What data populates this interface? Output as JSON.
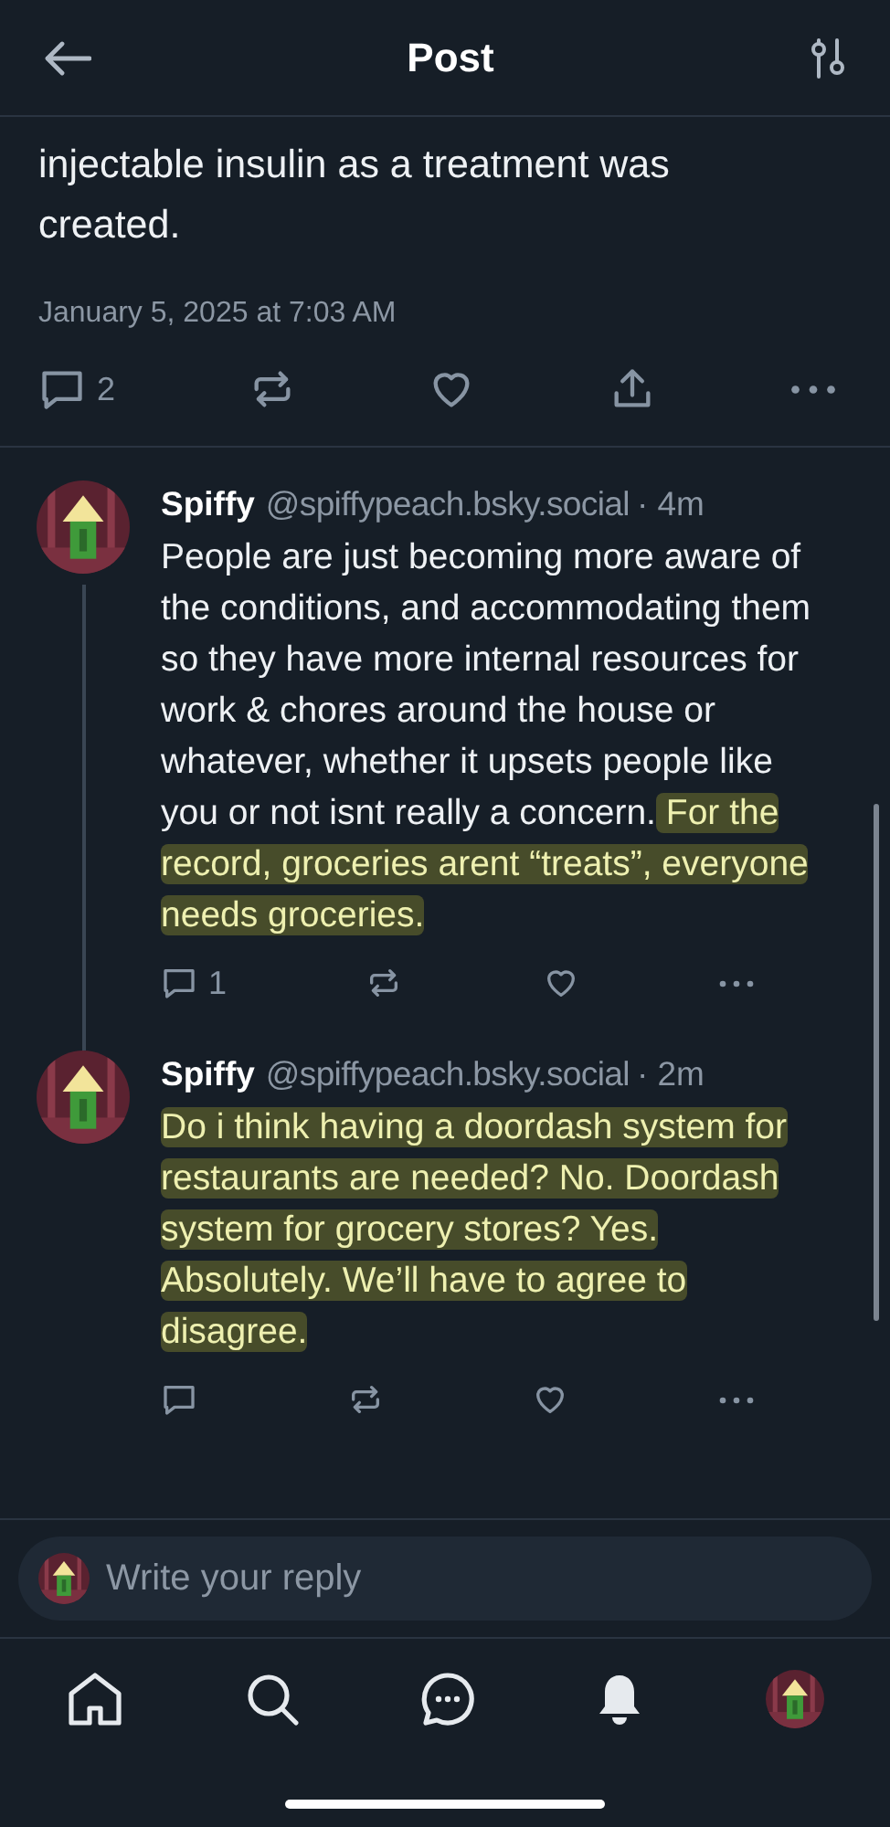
{
  "header": {
    "title": "Post"
  },
  "post": {
    "text": "injectable insulin as a treatment was created.",
    "timestamp": "January 5, 2025 at 7:03 AM",
    "reply_count": "2"
  },
  "replies": [
    {
      "author": "Spiffy",
      "handle": "@spiffypeach.bsky.social",
      "time": "· 4m",
      "thread_continues": true,
      "reply_count": "1",
      "body": [
        {
          "text": "People are just becoming more aware of the conditions, and accommodating them so they have more internal resources for work & chores around the house or whatever, whether it upsets people like you or not isnt really a concern.",
          "highlighted": false
        },
        {
          "text": "For the record, groceries arent “treats”, everyone needs groceries.",
          "highlighted": true
        }
      ]
    },
    {
      "author": "Spiffy",
      "handle": "@spiffypeach.bsky.social",
      "time": "· 2m",
      "thread_continues": false,
      "body": [
        {
          "text": "Do i think having a doordash system for restaurants are needed? No. Doordash system for grocery stores? Yes. Absolutely. We’ll have to agree to disagree.",
          "highlighted": true
        }
      ]
    }
  ],
  "composer": {
    "placeholder": "Write your reply"
  },
  "nav": [
    {
      "kind": "home"
    },
    {
      "kind": "search"
    },
    {
      "kind": "chat"
    },
    {
      "kind": "bell"
    },
    {
      "kind": "avatar"
    }
  ]
}
